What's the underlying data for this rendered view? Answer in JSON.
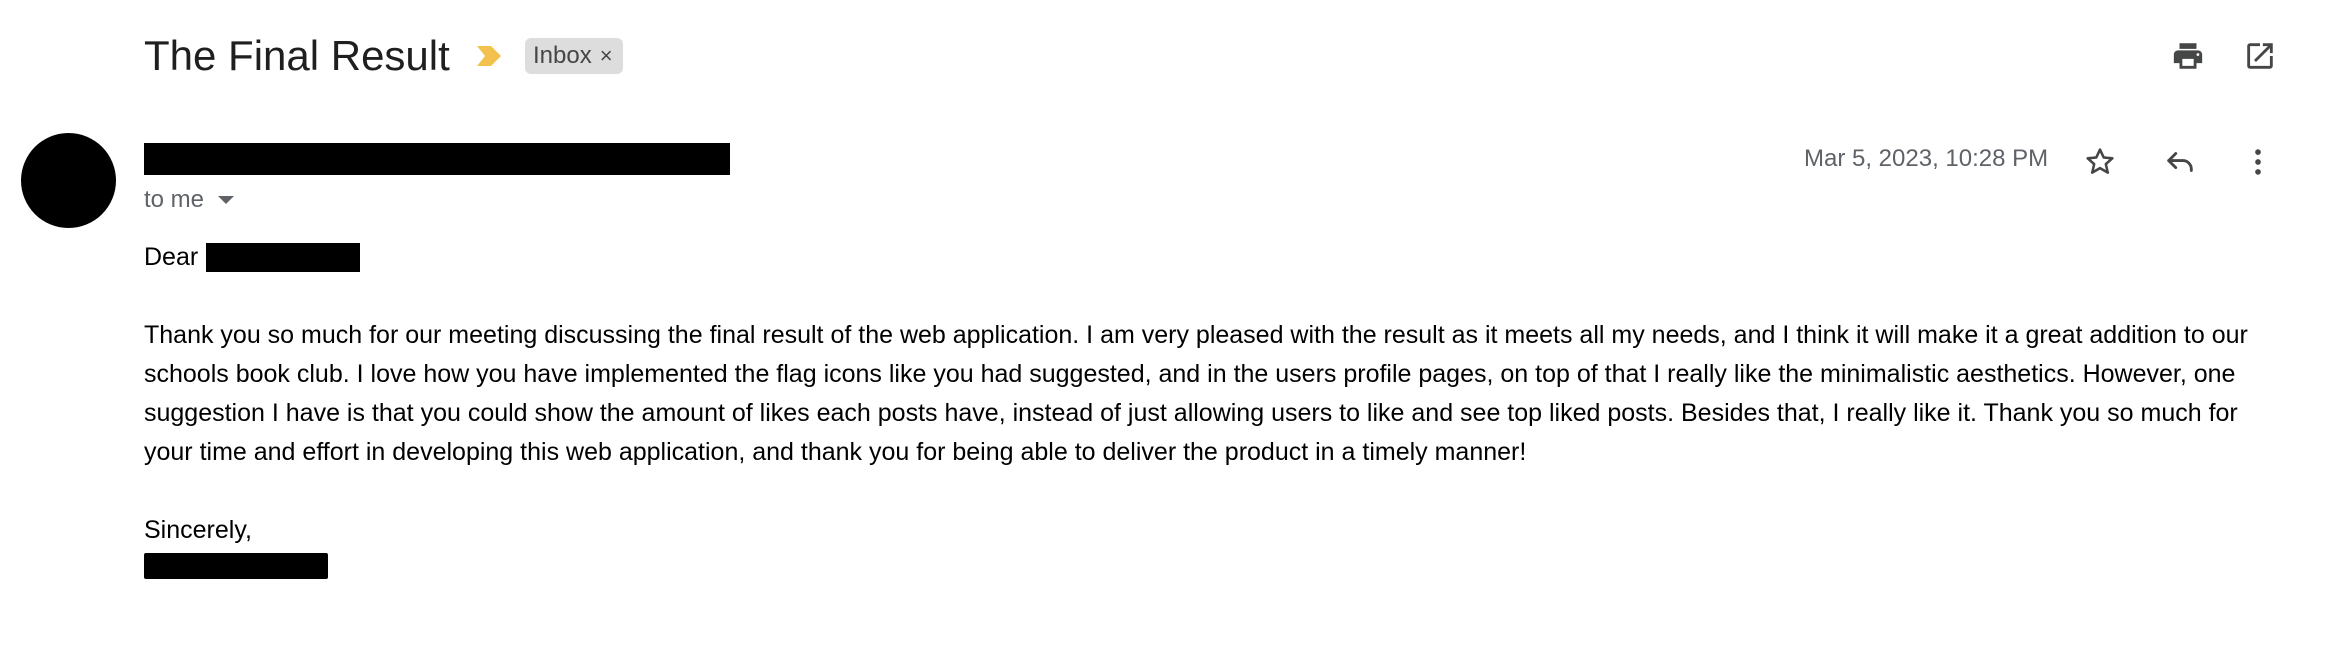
{
  "email": {
    "subject": "The Final Result",
    "label": "Inbox",
    "label_remove": "×",
    "recipient": "to me",
    "timestamp": "Mar 5, 2023, 10:28 PM",
    "greeting": "Dear",
    "body": "Thank you so much for our meeting discussing the final result of the web application. I am very pleased with the result as it meets all my needs, and I think it will make it a great addition to our schools book club. I love how you have implemented the flag icons like you had suggested, and in the users profile pages, on top of that I really like the minimalistic aesthetics. However, one suggestion I have is that you could show the amount of likes each posts have, instead of just allowing users to like and see top liked posts. Besides that, I really like it. Thank you so much for your time and effort in developing this web application, and thank you for being able to deliver the product in a timely manner!",
    "closing": "Sincerely,"
  },
  "icons": {
    "importance": "importance-marker-icon",
    "print": "print-icon",
    "open_new_window": "open-in-new-window-icon",
    "star": "star-icon",
    "reply": "reply-icon",
    "more": "more-vert-icon"
  },
  "colors": {
    "importance_marker": "#f2c14e",
    "chip_background": "#dddddd",
    "secondary_text": "#5f6368",
    "redaction": "#000000"
  }
}
